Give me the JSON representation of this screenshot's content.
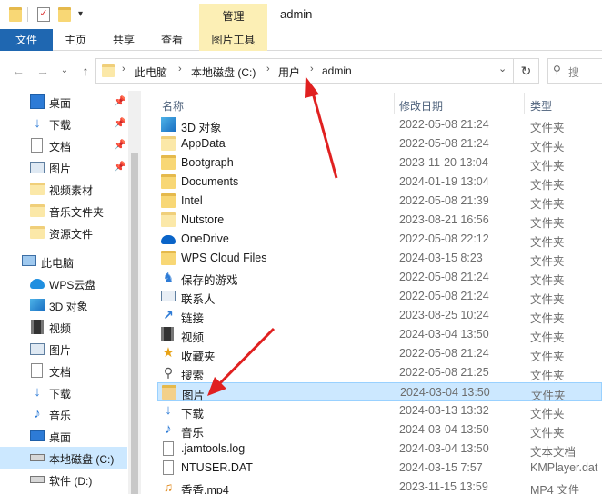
{
  "window_title": "admin",
  "ribbon": {
    "contextual_group": "管理",
    "tabs": [
      "文件",
      "主页",
      "共享",
      "查看",
      "图片工具"
    ]
  },
  "address": {
    "crumbs": [
      "此电脑",
      "本地磁盘 (C:)",
      "用户",
      "admin"
    ],
    "search_placeholder": "搜"
  },
  "nav": {
    "quick_access": [
      {
        "label": "桌面",
        "icon": "desktop-icon",
        "pinned": true
      },
      {
        "label": "下载",
        "icon": "download-icon",
        "pinned": true
      },
      {
        "label": "文档",
        "icon": "document-icon",
        "pinned": true
      },
      {
        "label": "图片",
        "icon": "picture-icon",
        "pinned": true
      },
      {
        "label": "视频素材",
        "icon": "folder-icon",
        "pinned": false
      },
      {
        "label": "音乐文件夹",
        "icon": "folder-icon",
        "pinned": false
      },
      {
        "label": "资源文件",
        "icon": "folder-icon",
        "pinned": false
      }
    ],
    "this_pc": "此电脑",
    "pc_items": [
      {
        "label": "WPS云盘",
        "icon": "cloud-icon"
      },
      {
        "label": "3D 对象",
        "icon": "3d-objects-icon"
      },
      {
        "label": "视频",
        "icon": "video-icon"
      },
      {
        "label": "图片",
        "icon": "picture-icon"
      },
      {
        "label": "文档",
        "icon": "document-icon"
      },
      {
        "label": "下载",
        "icon": "download-icon"
      },
      {
        "label": "音乐",
        "icon": "music-icon"
      },
      {
        "label": "桌面",
        "icon": "desktop-icon"
      },
      {
        "label": "本地磁盘 (C:)",
        "icon": "drive-icon",
        "selected": true
      },
      {
        "label": "软件 (D:)",
        "icon": "drive-icon"
      }
    ]
  },
  "columns": {
    "name": "名称",
    "date": "修改日期",
    "type": "类型"
  },
  "files": [
    {
      "name": "3D 对象",
      "date": "2022-05-08 21:24",
      "type": "文件夹",
      "icon": "3d-objects-icon"
    },
    {
      "name": "AppData",
      "date": "2022-05-08 21:24",
      "type": "文件夹",
      "icon": "folder-icon"
    },
    {
      "name": "Bootgraph",
      "date": "2023-11-20 13:04",
      "type": "文件夹",
      "icon": "folder-icon"
    },
    {
      "name": "Documents",
      "date": "2024-01-19 13:04",
      "type": "文件夹",
      "icon": "folder-icon"
    },
    {
      "name": "Intel",
      "date": "2022-05-08 21:39",
      "type": "文件夹",
      "icon": "folder-icon"
    },
    {
      "name": "Nutstore",
      "date": "2023-08-21 16:56",
      "type": "文件夹",
      "icon": "folder-icon"
    },
    {
      "name": "OneDrive",
      "date": "2022-05-08 22:12",
      "type": "文件夹",
      "icon": "onedrive-icon"
    },
    {
      "name": "WPS Cloud Files",
      "date": "2024-03-15 8:23",
      "type": "文件夹",
      "icon": "folder-icon"
    },
    {
      "name": "保存的游戏",
      "date": "2022-05-08 21:24",
      "type": "文件夹",
      "icon": "saved-games-icon"
    },
    {
      "name": "联系人",
      "date": "2022-05-08 21:24",
      "type": "文件夹",
      "icon": "contacts-icon"
    },
    {
      "name": "链接",
      "date": "2023-08-25 10:24",
      "type": "文件夹",
      "icon": "link-icon"
    },
    {
      "name": "视频",
      "date": "2024-03-04 13:50",
      "type": "文件夹",
      "icon": "video-icon"
    },
    {
      "name": "收藏夹",
      "date": "2022-05-08 21:24",
      "type": "文件夹",
      "icon": "favorites-icon"
    },
    {
      "name": "搜索",
      "date": "2022-05-08 21:25",
      "type": "文件夹",
      "icon": "search-icon"
    },
    {
      "name": "图片",
      "date": "2024-03-04 13:50",
      "type": "文件夹",
      "icon": "picture-icon",
      "selected": true
    },
    {
      "name": "下载",
      "date": "2024-03-13 13:32",
      "type": "文件夹",
      "icon": "download-icon"
    },
    {
      "name": "音乐",
      "date": "2024-03-04 13:50",
      "type": "文件夹",
      "icon": "music-icon"
    },
    {
      "name": ".jamtools.log",
      "date": "2024-03-04 13:50",
      "type": "文本文档",
      "icon": "text-file-icon"
    },
    {
      "name": "NTUSER.DAT",
      "date": "2024-03-15 7:57",
      "type": "KMPlayer.dat",
      "icon": "file-icon"
    },
    {
      "name": "香香.mp4",
      "date": "2023-11-15 13:59",
      "type": "MP4 文件",
      "icon": "mp4-file-icon"
    }
  ],
  "colors": {
    "file_tab": "#1f67b1",
    "contextual_tab": "#fcefb5",
    "selection": "#cce8ff",
    "annotation_arrow": "#e02020"
  }
}
